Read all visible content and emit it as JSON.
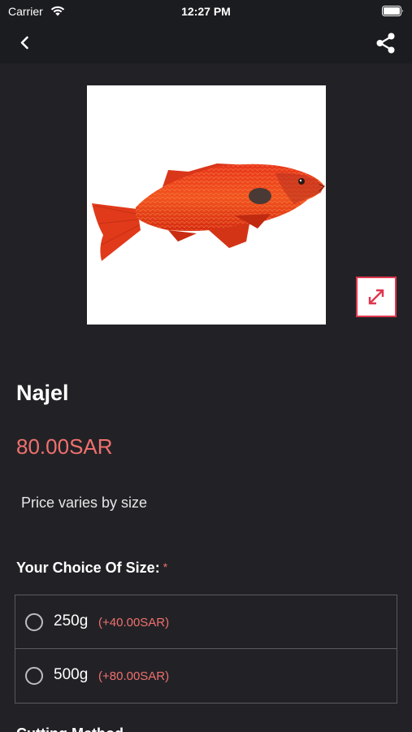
{
  "status_bar": {
    "carrier": "Carrier",
    "time": "12:27 PM"
  },
  "nav": {
    "back_icon": "chevron-left-icon",
    "share_icon": "share-icon"
  },
  "product": {
    "image": "red-fish-photo",
    "expand_icon": "expand-arrows-icon",
    "name": "Najel",
    "price": "80.00SAR",
    "price_note": "Price varies by size"
  },
  "size_section": {
    "heading": "Your Choice Of Size:",
    "required_mark": "*",
    "options": [
      {
        "label": "250g",
        "price": "(+40.00SAR)"
      },
      {
        "label": "500g",
        "price": "(+80.00SAR)"
      }
    ]
  },
  "next_section": {
    "heading": "Cutting Method"
  },
  "colors": {
    "background": "#222226",
    "accent": "#f0706e",
    "expand_border": "#e0364e"
  }
}
